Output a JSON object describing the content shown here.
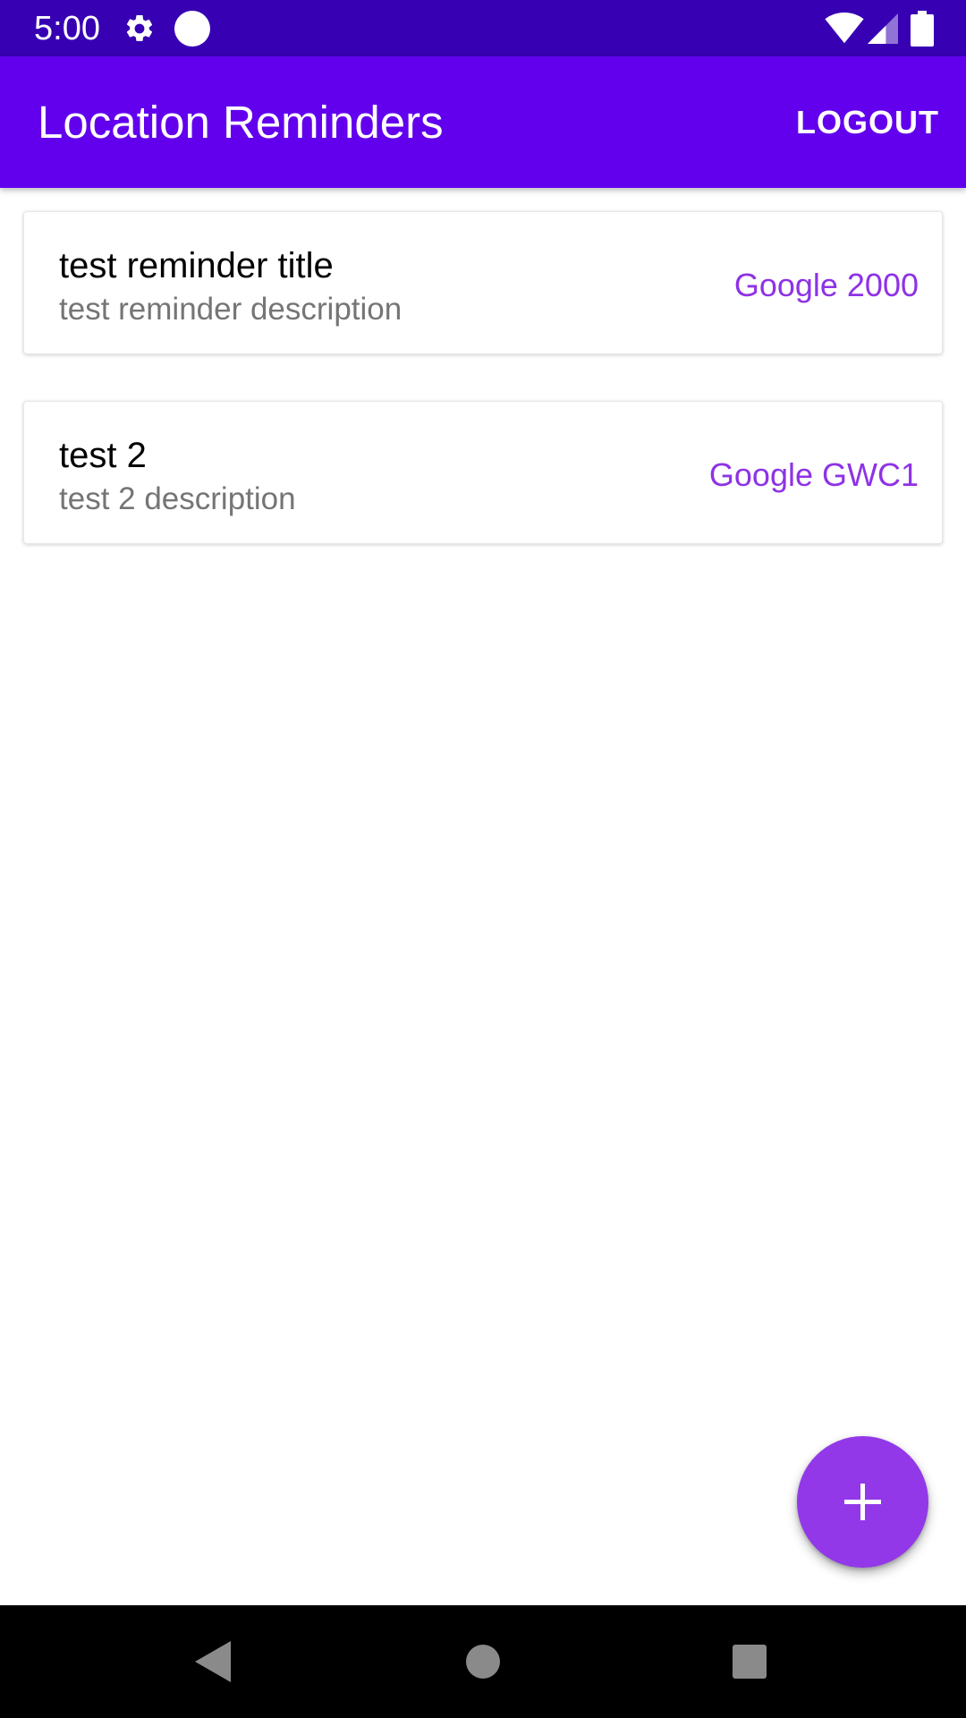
{
  "status_bar": {
    "time": "5:00",
    "icons": [
      "gear-icon",
      "circle-notification-icon",
      "wifi-icon",
      "signal-icon",
      "battery-icon"
    ]
  },
  "app_bar": {
    "title": "Location Reminders",
    "logout_label": "LOGOUT"
  },
  "reminders": [
    {
      "title": "test reminder title",
      "description": "test reminder description",
      "location": "Google 2000"
    },
    {
      "title": "test 2",
      "description": "test 2 description",
      "location": "Google GWC1"
    }
  ],
  "fab": {
    "icon": "plus-icon"
  },
  "nav_bar": {
    "icons": [
      "back-icon",
      "home-icon",
      "recents-icon"
    ]
  },
  "colors": {
    "status_bar": "#3700b3",
    "app_bar": "#6200ee",
    "accent": "#9238e8",
    "location_text": "#8e32e6",
    "description_text": "#757575"
  }
}
